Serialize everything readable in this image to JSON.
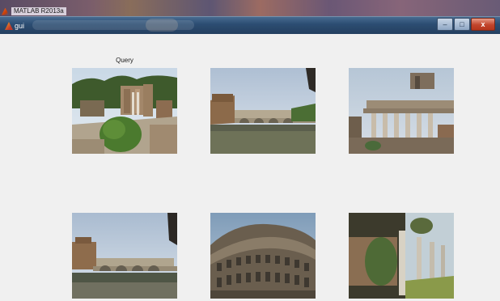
{
  "taskbar": {
    "app_title": "MATLAB R2013a",
    "logo_icon": "matlab-logo-icon"
  },
  "window": {
    "title": "gui",
    "icon": "figure-window-icon",
    "controls": {
      "minimize_icon": "minimize-icon",
      "maximize_icon": "maximize-icon",
      "close_icon": "close-icon",
      "minimize_glyph": "–",
      "maximize_glyph": "□",
      "close_glyph": "x"
    }
  },
  "main": {
    "query_label": "Query",
    "images": [
      {
        "subject": "roman-forum-ruins"
      },
      {
        "subject": "castel-santangelo-bridge"
      },
      {
        "subject": "ruined-temple-columns"
      },
      {
        "subject": "castel-santangelo-bridge-2"
      },
      {
        "subject": "colosseum"
      },
      {
        "subject": "ruins-columns-garden"
      }
    ]
  },
  "colors": {
    "titlebar": "#2c4d72",
    "background": "#f0f0f0",
    "close_button": "#c2452c"
  }
}
